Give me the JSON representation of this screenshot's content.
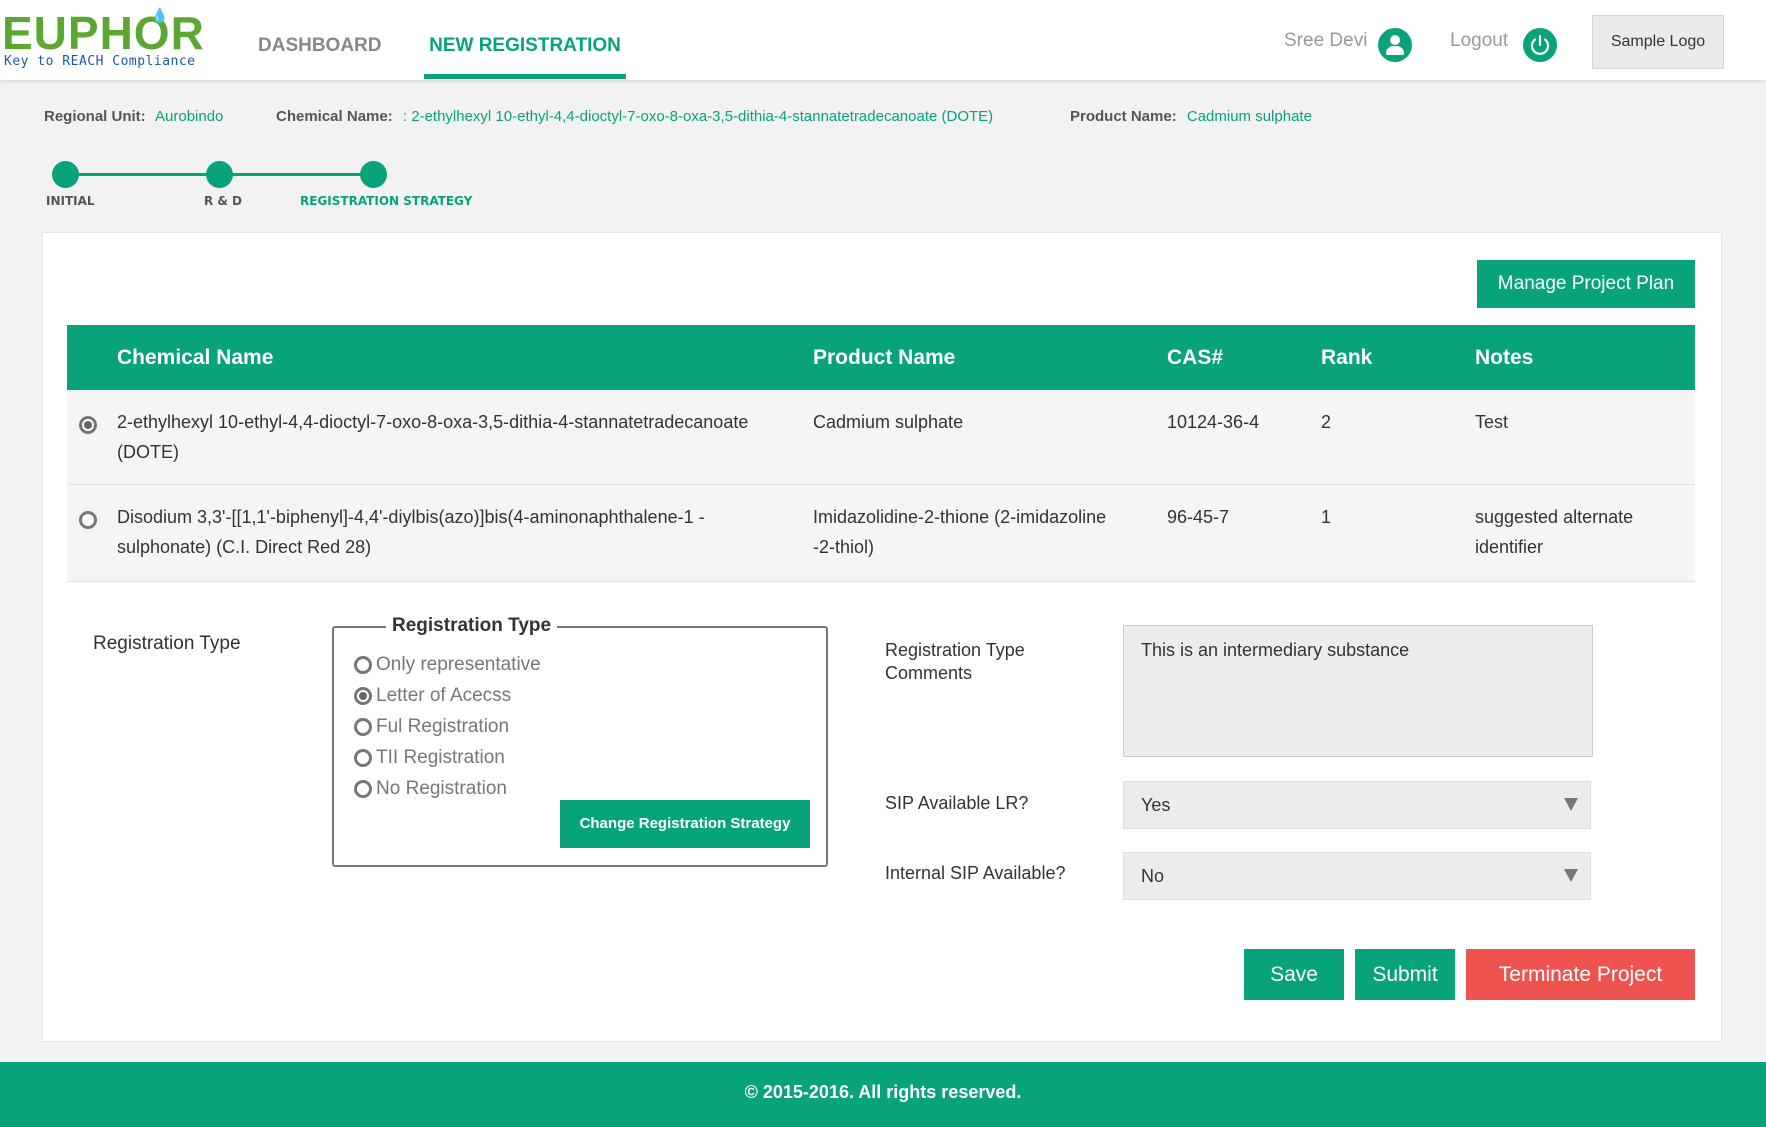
{
  "brand": {
    "logo_text": "EUPHOR",
    "tagline": "Key to REACH Compliance"
  },
  "nav": {
    "dashboard": "DASHBOARD",
    "new_registration": "NEW REGISTRATION"
  },
  "user": {
    "name": "Sree Devi",
    "logout": "Logout",
    "sample_logo": "Sample  Logo"
  },
  "info": {
    "regional_unit_label": "Regional Unit:",
    "regional_unit_value": "Aurobindo",
    "chemical_name_label": "Chemical Name:",
    "chemical_name_value": ": 2-ethylhexyl 10-ethyl-4,4-dioctyl-7-oxo-8-oxa-3,5-dithia-4-stannatetradecanoate (DOTE)",
    "product_name_label": "Product Name:",
    "product_name_value": "Cadmium sulphate"
  },
  "steps": [
    "INITIAL",
    "R & D",
    "REGISTRATION STRATEGY"
  ],
  "manage_button": "Manage Project Plan",
  "table": {
    "headers": [
      "Chemical Name",
      "Product Name",
      "CAS#",
      "Rank",
      "Notes"
    ],
    "rows": [
      {
        "chemical": "2-ethylhexyl 10-ethyl-4,4-dioctyl-7-oxo-8-oxa-3,5-dithia-4-stannatetradecanoate (DOTE)",
        "product": "Cadmium sulphate",
        "cas": "10124-36-4",
        "rank": "2",
        "notes": "Test",
        "selected": true
      },
      {
        "chemical": "Disodium 3,3'-[[1,1'-biphenyl]-4,4'-diylbis(azo)]bis(4-aminonaphthalene-1 -sulphonate) (C.I. Direct Red 28)",
        "product": "Imidazolidine-2-thione (2-imidazoline -2-thiol)",
        "cas": "96-45-7",
        "rank": "1",
        "notes": "suggested alternate identifier",
        "selected": false
      }
    ]
  },
  "registration": {
    "label": "Registration Type",
    "legend": "Registration Type",
    "options": [
      "Only representative",
      "Letter of Acecss",
      "Ful Registration",
      "TII Registration",
      "No Registration"
    ],
    "selected_index": 1,
    "change_button": "Change Registration Strategy",
    "comments_label": "Registration Type Comments",
    "comments_value": "This is an intermediary substance",
    "sip_label": "SIP Available LR?",
    "sip_value": "Yes",
    "internal_sip_label": "Internal SIP Available?",
    "internal_sip_value": "No"
  },
  "actions": {
    "save": "Save",
    "submit": "Submit",
    "terminate": "Terminate Project"
  },
  "footer": "© 2015-2016. All rights reserved.",
  "colors": {
    "accent": "#08a37a",
    "danger": "#ef5350",
    "logo_green": "#5aa832",
    "logo_blue": "#1e5aa8"
  }
}
